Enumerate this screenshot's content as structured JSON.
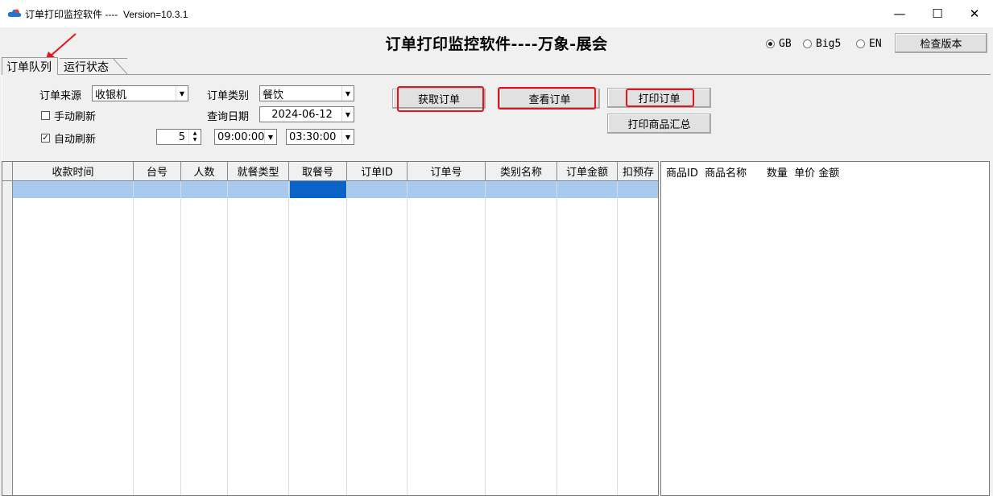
{
  "window": {
    "title": "订单打印监控软件 ----  Version=10.3.1",
    "minimize": "—",
    "maximize": "☐",
    "close": "✕"
  },
  "header": {
    "heading": "订单打印监控软件----万象-展会",
    "lang_options": [
      {
        "label": "GB",
        "selected": true
      },
      {
        "label": "Big5",
        "selected": false
      },
      {
        "label": "EN",
        "selected": false
      }
    ],
    "check_version": "检查版本"
  },
  "tabs": [
    {
      "label": "订单队列",
      "active": true
    },
    {
      "label": "运行状态",
      "active": false
    }
  ],
  "filters": {
    "source_label": "订单来源",
    "source_value": "收银机",
    "category_label": "订单类别",
    "category_value": "餐饮",
    "date_label": "查询日期",
    "date_value": "2024-06-12",
    "manual_refresh": {
      "label": "手动刷新",
      "checked": false
    },
    "auto_refresh": {
      "label": "自动刷新",
      "checked": true
    },
    "interval_value": "5",
    "start_time": "09:00:00",
    "end_time": "03:30:00"
  },
  "actions": {
    "fetch": "获取订单",
    "view": "查看订单",
    "print": "打印订单",
    "print_summary": "打印商品汇总"
  },
  "grid": {
    "columns": [
      "收款时间",
      "台号",
      "人数",
      "就餐类型",
      "取餐号",
      "订单ID",
      "订单号",
      "类别名称",
      "订单金额",
      "扣预存"
    ]
  },
  "detail": {
    "header": "商品ID  商品名称      数量  单价 金额"
  },
  "colors": {
    "highlight_red": "#e8141b",
    "row_selected": "#a8caee",
    "cell_selected": "#0a64c8"
  }
}
